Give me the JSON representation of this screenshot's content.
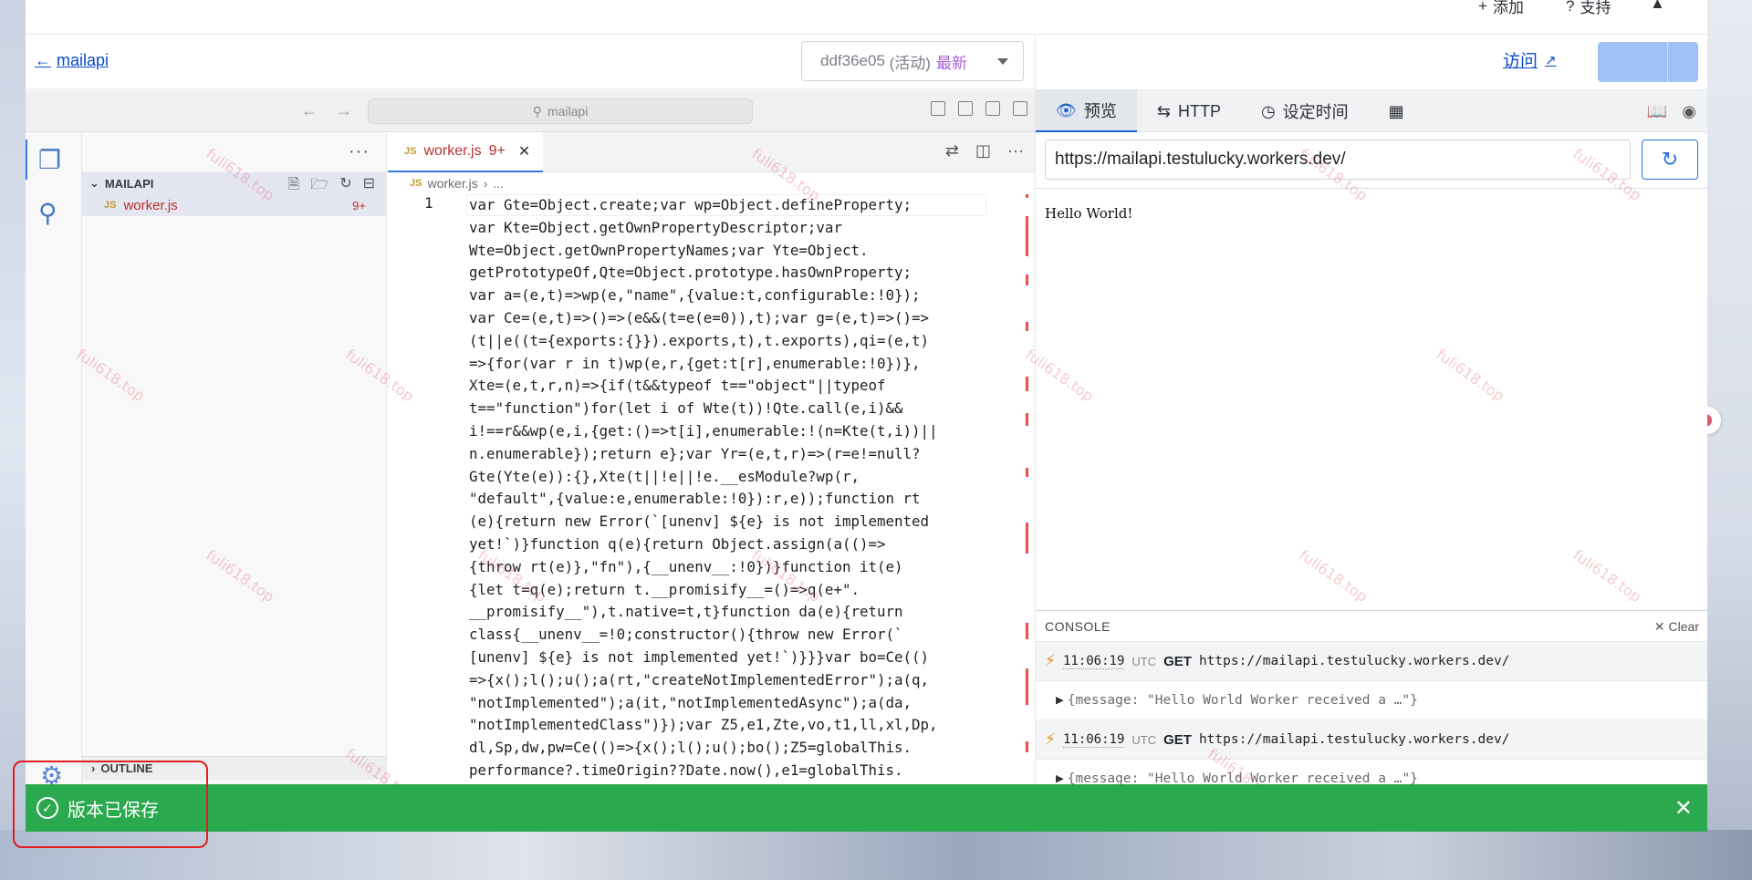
{
  "top_bar": {
    "add_label": "添加",
    "support_label": "支持"
  },
  "header": {
    "back_label": "mailapi",
    "version_hash": "ddf36e05",
    "version_state": "(活动)",
    "version_latest": "最新"
  },
  "vscode": {
    "command_center": "mailapi",
    "explorer_folder": "MAILAPI",
    "file_name": "worker.js",
    "file_badge": "9+",
    "file_type": "JS",
    "outline_label": "OUTLINE",
    "tab_label": "worker.js",
    "tab_badge": "9+",
    "breadcrumb_file": "worker.js",
    "breadcrumb_more": "...",
    "line_number": "1",
    "code": "var Gte=Object.create;var wp=Object.defineProperty;\nvar Kte=Object.getOwnPropertyDescriptor;var\nWte=Object.getOwnPropertyNames;var Yte=Object.\ngetPrototypeOf,Qte=Object.prototype.hasOwnProperty;\nvar a=(e,t)=>wp(e,\"name\",{value:t,configurable:!0});\nvar Ce=(e,t)=>()=>(e&&(t=e(e=0)),t);var g=(e,t)=>()=>\n(t||e((t={exports:{}}).exports,t),t.exports),qi=(e,t)\n=>{for(var r in t)wp(e,r,{get:t[r],enumerable:!0})},\nXte=(e,t,r,n)=>{if(t&&typeof t==\"object\"||typeof\nt==\"function\")for(let i of Wte(t))!Qte.call(e,i)&&\ni!==r&&wp(e,i,{get:()=>t[i],enumerable:!(n=Kte(t,i))||\nn.enumerable});return e};var Yr=(e,t,r)=>(r=e!=null?\nGte(Yte(e)):{},Xte(t||!e||!e.__esModule?wp(r,\n\"default\",{value:e,enumerable:!0}):r,e));function rt\n(e){return new Error(`[unenv] ${e} is not implemented\nyet!`)}function q(e){return Object.assign(a(()=>\n{throw rt(e)},\"fn\"),{__unenv__:!0})}function it(e)\n{let t=q(e);return t.__promisify__=()=>q(e+\".\n__promisify__\"),t.native=t,t}function da(e){return\nclass{__unenv__=!0;constructor(){throw new Error(`\n[unenv] ${e} is not implemented yet!`)}}}var bo=Ce(()\n=>{x();l();u();a(rt,\"createNotImplementedError\");a(q,\n\"notImplemented\");a(it,\"notImplementedAsync\");a(da,\n\"notImplementedClass\")});var Z5,e1,Zte,vo,t1,ll,xl,Dp,\ndl,Sp,dw,pw=Ce(()=>{x();l();u();bo();Z5=globalThis.\nperformance?.timeOrigin??Date.now(),e1=globalThis."
  },
  "right_panel": {
    "visit_label": "访问",
    "tabs": [
      {
        "icon": "eye-icon",
        "label": "预览"
      },
      {
        "icon": "arrows-icon",
        "label": "HTTP"
      },
      {
        "icon": "clock-icon",
        "label": "设定时间"
      }
    ],
    "url_value": "https://mailapi.testulucky.workers.dev/",
    "preview_text": "Hello World!",
    "console": {
      "title": "CONSOLE",
      "clear_label": "Clear",
      "logs": [
        {
          "time": "11:06:19",
          "tz": "UTC",
          "method": "GET",
          "url": "https://mailapi.testulucky.workers.dev/",
          "message": "{message: \"Hello World Worker received a …\"}"
        },
        {
          "time": "11:06:19",
          "tz": "UTC",
          "method": "GET",
          "url": "https://mailapi.testulucky.workers.dev/",
          "message": "{message: \"Hello World Worker received a …\"}"
        }
      ]
    }
  },
  "toast": {
    "message": "版本已保存"
  },
  "watermark": "fuli618.top",
  "colors": {
    "accent": "#0a4bc8",
    "success": "#2ba94e",
    "highlight": "#e11d1d"
  }
}
